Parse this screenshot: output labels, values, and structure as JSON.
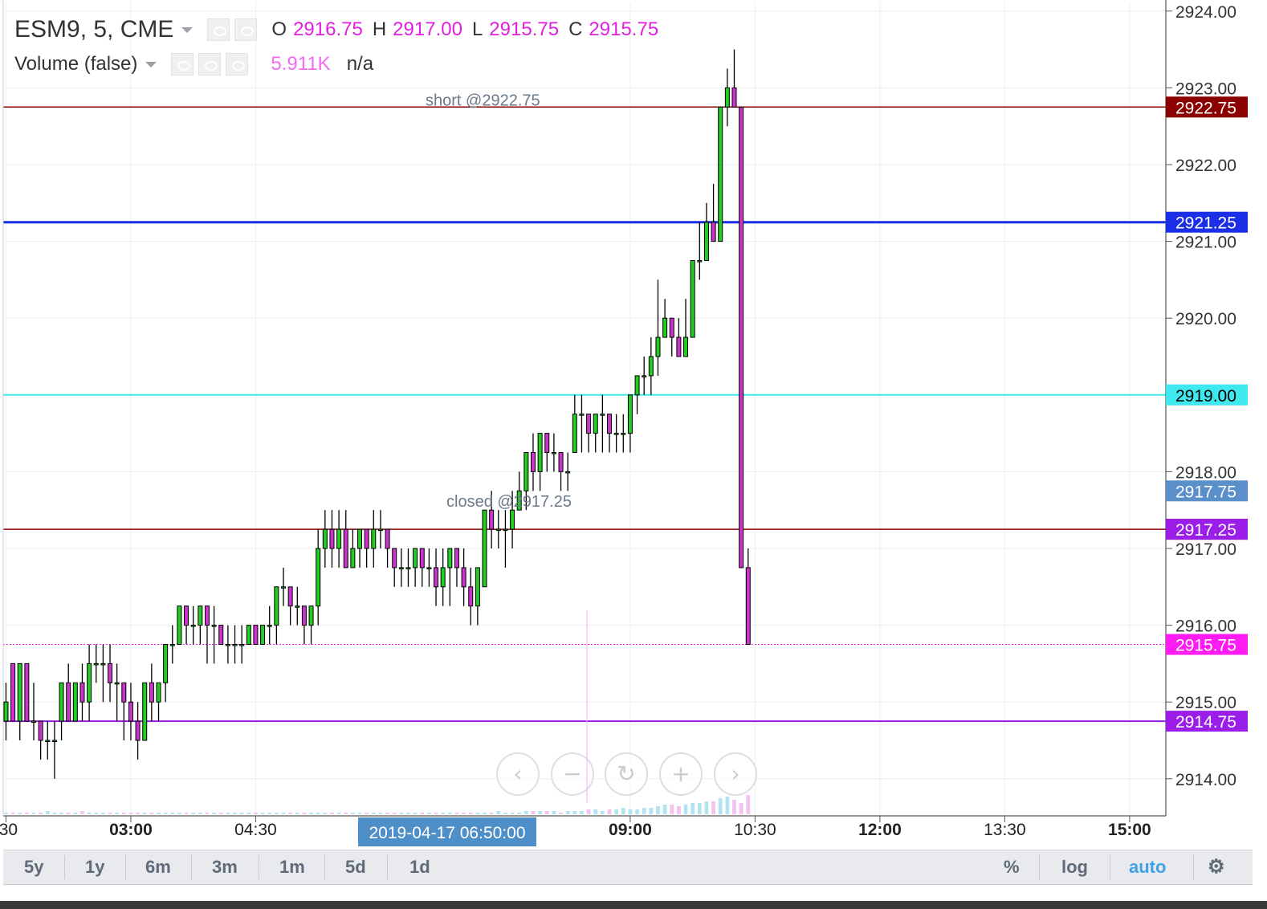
{
  "legend": {
    "symbol": "ESM9, 5, CME",
    "o_label": "O",
    "o_value": "2916.75",
    "h_label": "H",
    "h_value": "2917.00",
    "l_label": "L",
    "l_value": "2915.75",
    "c_label": "C",
    "c_value": "2915.75",
    "volume_label": "Volume (false)",
    "volume_value": "5.911K",
    "volume_extra": "n/a"
  },
  "toolbar": {
    "ranges": [
      "5y",
      "1y",
      "6m",
      "3m",
      "1m",
      "5d",
      "1d"
    ],
    "percent": "%",
    "log": "log",
    "auto": "auto"
  },
  "colors": {
    "up": "#22cc22",
    "down": "#cc33cc",
    "short_line": "#8b0000",
    "blue_line": "#1a2fe6",
    "cyan_line": "#3ee8ee",
    "closed_line": "#8b0000",
    "last_price": "#ff1cf3",
    "purple_line": "#9b1de8",
    "accent": "#4a90e2"
  },
  "chart_data": {
    "type": "candlestick",
    "ylim": [
      2913.4,
      2924.0
    ],
    "y_ticks": [
      2914.0,
      2915.0,
      2916.0,
      2917.0,
      2918.0,
      2919.0,
      2920.0,
      2921.0,
      2922.0,
      2923.0,
      2924.0
    ],
    "y_tick_labels": [
      "2914.00",
      "2915.00",
      "2916.00",
      "2917.00",
      "2918.00",
      "2919.00",
      "2920.00",
      "2921.00",
      "2922.00",
      "2923.00",
      "2924.00"
    ],
    "x_ticks": [
      {
        "label": ":30",
        "bold": false,
        "minutes": 90
      },
      {
        "label": "03:00",
        "bold": true,
        "minutes": 180
      },
      {
        "label": "04:30",
        "bold": false,
        "minutes": 270
      },
      {
        "label": "09:00",
        "bold": true,
        "minutes": 540
      },
      {
        "label": "10:30",
        "bold": false,
        "minutes": 630
      },
      {
        "label": "12:00",
        "bold": true,
        "minutes": 720
      },
      {
        "label": "13:30",
        "bold": false,
        "minutes": 810
      },
      {
        "label": "15:00",
        "bold": true,
        "minutes": 900
      }
    ],
    "x_range_minutes": [
      88,
      928
    ],
    "bar_interval_minutes": 5,
    "first_bar_minutes": 90,
    "crosshair_label": "2019-04-17 06:50:00",
    "crosshair_minutes": 410,
    "horizontal_lines": [
      {
        "price": 2922.75,
        "label": "2922.75",
        "color": "#8b0000",
        "text_color": "#ffffff",
        "text": "short @2922.75",
        "width": 1.5
      },
      {
        "price": 2921.25,
        "label": "2921.25",
        "color": "#1a2fe6",
        "text_color": "#ffffff",
        "text": "",
        "width": 3
      },
      {
        "price": 2919.0,
        "label": "2919.00",
        "color": "#3ee8ee",
        "text_color": "#000000",
        "text": "",
        "width": 2
      },
      {
        "price": 2917.25,
        "label": "2917.25",
        "color": "#8b0000",
        "text_color": "#ffffff",
        "text": "closed @2917.25",
        "width": 1.5
      },
      {
        "price": 2915.75,
        "label": "2915.75",
        "color": "#ff1cf3",
        "text_color": "#ffffff",
        "text": "",
        "width": 1,
        "dashed": true
      },
      {
        "price": 2914.75,
        "label": "2914.75",
        "color": "#9b1de8",
        "text_color": "#ffffff",
        "text": "",
        "width": 2
      }
    ],
    "extra_price_labels": [
      {
        "price": 2917.75,
        "label": "2917.75",
        "color": "#5b8fc9"
      },
      {
        "price": 2917.25,
        "label": "2917.25",
        "color": "#9b1de8"
      }
    ],
    "ohlc": [
      [
        2914.75,
        2915.25,
        2914.5,
        2915.0
      ],
      [
        2915.5,
        2915.5,
        2914.75,
        2914.75
      ],
      [
        2914.75,
        2915.5,
        2914.5,
        2915.5
      ],
      [
        2915.5,
        2915.5,
        2914.75,
        2914.75
      ],
      [
        2914.75,
        2915.25,
        2914.5,
        2914.75
      ],
      [
        2914.75,
        2914.75,
        2914.25,
        2914.5
      ],
      [
        2914.5,
        2914.75,
        2914.25,
        2914.5
      ],
      [
        2914.5,
        2914.75,
        2914.0,
        2914.5
      ],
      [
        2914.75,
        2915.25,
        2914.5,
        2915.25
      ],
      [
        2915.25,
        2915.5,
        2914.75,
        2914.75
      ],
      [
        2914.75,
        2915.25,
        2914.75,
        2915.25
      ],
      [
        2915.25,
        2915.5,
        2914.75,
        2915.0
      ],
      [
        2915.0,
        2915.75,
        2914.75,
        2915.5
      ],
      [
        2915.5,
        2915.75,
        2915.25,
        2915.5
      ],
      [
        2915.5,
        2915.75,
        2915.0,
        2915.5
      ],
      [
        2915.5,
        2915.75,
        2915.0,
        2915.25
      ],
      [
        2915.25,
        2915.5,
        2914.75,
        2915.25
      ],
      [
        2915.25,
        2915.25,
        2914.5,
        2915.0
      ],
      [
        2915.0,
        2915.25,
        2914.5,
        2914.75
      ],
      [
        2914.75,
        2915.0,
        2914.25,
        2914.5
      ],
      [
        2914.5,
        2915.25,
        2914.5,
        2915.25
      ],
      [
        2915.25,
        2915.5,
        2914.75,
        2915.0
      ],
      [
        2915.0,
        2915.25,
        2914.75,
        2915.25
      ],
      [
        2915.25,
        2915.75,
        2915.0,
        2915.75
      ],
      [
        2915.75,
        2916.0,
        2915.5,
        2915.75
      ],
      [
        2915.75,
        2916.25,
        2915.75,
        2916.25
      ],
      [
        2916.25,
        2916.25,
        2915.75,
        2916.0
      ],
      [
        2916.0,
        2916.25,
        2915.75,
        2916.0
      ],
      [
        2916.0,
        2916.25,
        2915.75,
        2916.25
      ],
      [
        2916.25,
        2916.25,
        2915.5,
        2916.0
      ],
      [
        2916.0,
        2916.25,
        2915.5,
        2916.0
      ],
      [
        2916.0,
        2916.0,
        2915.75,
        2915.75
      ],
      [
        2915.75,
        2916.0,
        2915.5,
        2915.75
      ],
      [
        2915.75,
        2916.0,
        2915.5,
        2915.75
      ],
      [
        2915.75,
        2916.0,
        2915.5,
        2915.75
      ],
      [
        2915.75,
        2916.0,
        2915.75,
        2916.0
      ],
      [
        2916.0,
        2916.0,
        2915.75,
        2915.75
      ],
      [
        2915.75,
        2916.0,
        2915.75,
        2916.0
      ],
      [
        2916.0,
        2916.25,
        2915.75,
        2916.0
      ],
      [
        2916.0,
        2916.5,
        2915.75,
        2916.5
      ],
      [
        2916.5,
        2916.75,
        2916.25,
        2916.5
      ],
      [
        2916.5,
        2916.5,
        2916.0,
        2916.25
      ],
      [
        2916.25,
        2916.5,
        2916.0,
        2916.25
      ],
      [
        2916.25,
        2916.25,
        2915.75,
        2916.0
      ],
      [
        2916.0,
        2916.25,
        2915.75,
        2916.25
      ],
      [
        2916.25,
        2917.25,
        2916.0,
        2917.0
      ],
      [
        2917.0,
        2917.5,
        2916.75,
        2917.25
      ],
      [
        2917.25,
        2917.5,
        2916.75,
        2917.0
      ],
      [
        2917.0,
        2917.5,
        2916.75,
        2917.25
      ],
      [
        2917.25,
        2917.5,
        2916.75,
        2916.75
      ],
      [
        2916.75,
        2917.25,
        2916.75,
        2917.0
      ],
      [
        2917.0,
        2917.25,
        2916.75,
        2917.25
      ],
      [
        2917.25,
        2917.25,
        2916.75,
        2917.0
      ],
      [
        2917.0,
        2917.5,
        2916.75,
        2917.25
      ],
      [
        2917.25,
        2917.5,
        2917.0,
        2917.25
      ],
      [
        2917.25,
        2917.25,
        2916.75,
        2917.0
      ],
      [
        2917.0,
        2917.0,
        2916.5,
        2916.75
      ],
      [
        2916.75,
        2917.0,
        2916.5,
        2916.75
      ],
      [
        2916.75,
        2917.0,
        2916.5,
        2916.75
      ],
      [
        2916.75,
        2917.0,
        2916.5,
        2917.0
      ],
      [
        2917.0,
        2917.0,
        2916.5,
        2916.75
      ],
      [
        2916.75,
        2917.0,
        2916.5,
        2916.75
      ],
      [
        2916.75,
        2917.0,
        2916.25,
        2916.5
      ],
      [
        2916.5,
        2917.0,
        2916.25,
        2916.75
      ],
      [
        2916.75,
        2917.0,
        2916.25,
        2917.0
      ],
      [
        2917.0,
        2917.0,
        2916.5,
        2916.75
      ],
      [
        2916.75,
        2917.0,
        2916.25,
        2916.5
      ],
      [
        2916.5,
        2916.75,
        2916.0,
        2916.25
      ],
      [
        2916.25,
        2916.75,
        2916.0,
        2916.75
      ],
      [
        2916.5,
        2917.5,
        2916.5,
        2917.5
      ],
      [
        2917.5,
        2917.75,
        2917.0,
        2917.25
      ],
      [
        2917.25,
        2917.5,
        2917.0,
        2917.25
      ],
      [
        2917.25,
        2917.5,
        2916.75,
        2917.25
      ],
      [
        2917.25,
        2917.75,
        2917.0,
        2917.5
      ],
      [
        2917.5,
        2918.0,
        2917.5,
        2917.75
      ],
      [
        2917.75,
        2918.25,
        2917.5,
        2918.25
      ],
      [
        2918.25,
        2918.5,
        2917.75,
        2918.0
      ],
      [
        2918.0,
        2918.5,
        2917.75,
        2918.5
      ],
      [
        2918.5,
        2918.5,
        2918.0,
        2918.25
      ],
      [
        2918.25,
        2918.5,
        2918.0,
        2918.25
      ],
      [
        2918.25,
        2918.25,
        2917.75,
        2918.0
      ],
      [
        2918.0,
        2918.25,
        2917.75,
        2918.0
      ],
      [
        2918.25,
        2919.0,
        2918.25,
        2918.75
      ],
      [
        2918.75,
        2919.0,
        2918.25,
        2918.75
      ],
      [
        2918.75,
        2918.75,
        2918.25,
        2918.5
      ],
      [
        2918.5,
        2918.75,
        2918.25,
        2918.75
      ],
      [
        2918.75,
        2919.0,
        2918.25,
        2918.75
      ],
      [
        2918.75,
        2918.75,
        2918.25,
        2918.5
      ],
      [
        2918.5,
        2918.75,
        2918.25,
        2918.5
      ],
      [
        2918.5,
        2918.75,
        2918.25,
        2918.5
      ],
      [
        2918.5,
        2919.0,
        2918.25,
        2919.0
      ],
      [
        2919.0,
        2919.25,
        2918.75,
        2919.25
      ],
      [
        2919.25,
        2919.5,
        2919.0,
        2919.25
      ],
      [
        2919.25,
        2919.75,
        2919.0,
        2919.5
      ],
      [
        2919.5,
        2920.5,
        2919.25,
        2919.75
      ],
      [
        2919.75,
        2920.25,
        2919.75,
        2920.0
      ],
      [
        2920.0,
        2920.0,
        2919.5,
        2919.75
      ],
      [
        2919.75,
        2920.0,
        2919.5,
        2919.5
      ],
      [
        2919.5,
        2920.25,
        2919.5,
        2919.75
      ],
      [
        2919.75,
        2920.75,
        2919.75,
        2920.75
      ],
      [
        2920.75,
        2921.25,
        2920.5,
        2920.75
      ],
      [
        2920.75,
        2921.5,
        2920.75,
        2921.25
      ],
      [
        2921.25,
        2921.75,
        2921.0,
        2921.0
      ],
      [
        2921.0,
        2922.75,
        2921.0,
        2922.75
      ],
      [
        2922.75,
        2923.25,
        2922.5,
        2923.0
      ],
      [
        2923.0,
        2923.5,
        2922.75,
        2922.75
      ],
      [
        2922.75,
        2922.75,
        2916.75,
        2916.75
      ],
      [
        2916.75,
        2917.0,
        2915.75,
        2915.75
      ]
    ],
    "volume": [
      1,
      1,
      1,
      1,
      1,
      1,
      2,
      1,
      1,
      1,
      1,
      2,
      1,
      1,
      1,
      1,
      1,
      1,
      1,
      1,
      1,
      1,
      1,
      1,
      1,
      1,
      1,
      1,
      1,
      1,
      1,
      1,
      1,
      1,
      1,
      1,
      1,
      1,
      1,
      1,
      1,
      1,
      1,
      1,
      1,
      1,
      1,
      1,
      1,
      1,
      1,
      1,
      1,
      1,
      1,
      1,
      1,
      1,
      1,
      1,
      1,
      1,
      1,
      1,
      1,
      1,
      1,
      1,
      1,
      1,
      1,
      2,
      1,
      1,
      1,
      2,
      2,
      2,
      2,
      2,
      1,
      2,
      2,
      2,
      3,
      3,
      2,
      3,
      3,
      4,
      3,
      3,
      4,
      4,
      5,
      6,
      6,
      5,
      6,
      7,
      7,
      8,
      8,
      10,
      11,
      9,
      7,
      12
    ]
  }
}
